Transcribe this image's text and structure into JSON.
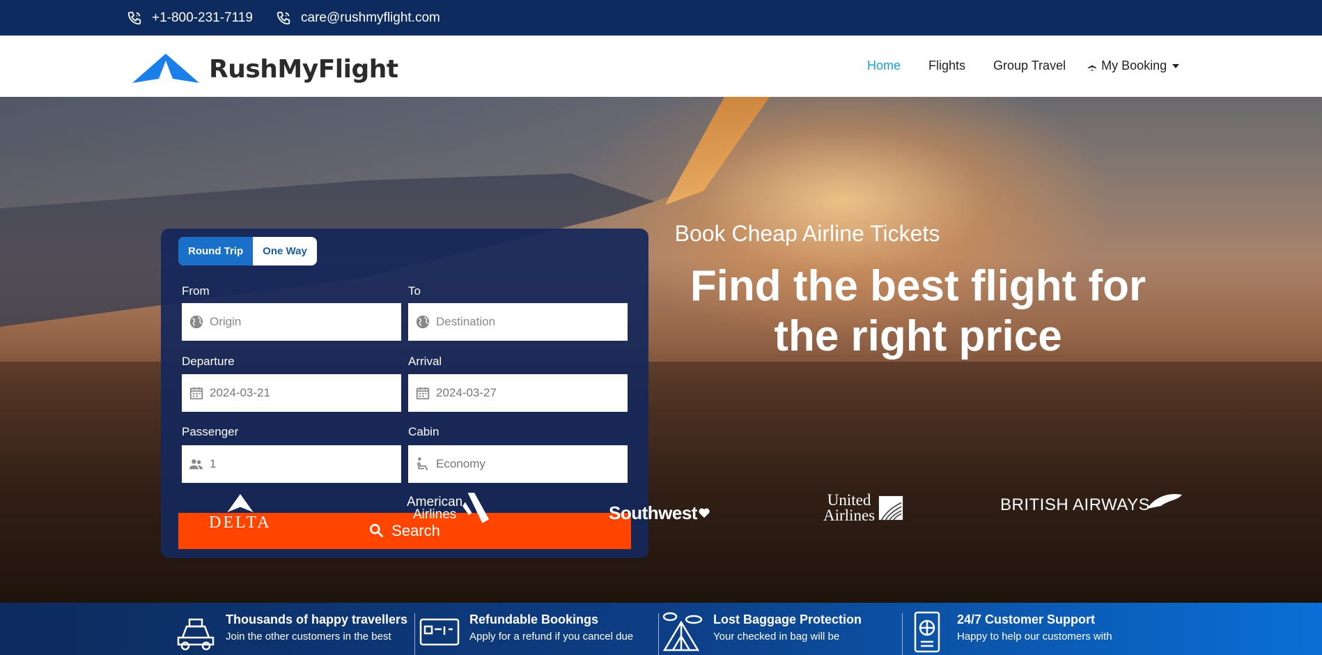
{
  "topbar": {
    "phone": "+1-800-231-7119",
    "email": "care@rushmyflight.com"
  },
  "brand": {
    "name": "RushMyFlight",
    "logo_color": "#1a7fe8"
  },
  "nav": {
    "items": [
      {
        "label": "Home",
        "active": true
      },
      {
        "label": "Flights",
        "active": false
      },
      {
        "label": "Group Travel",
        "active": false
      }
    ],
    "dropdown": {
      "label": "My Booking",
      "icon": "plane-icon"
    }
  },
  "search": {
    "trip_types": [
      "Round Trip",
      "One Way"
    ],
    "selected_trip": "Round Trip",
    "from": {
      "label": "From",
      "placeholder": "Origin",
      "icon": "globe-icon"
    },
    "to": {
      "label": "To",
      "placeholder": "Destination",
      "icon": "globe-icon"
    },
    "departure": {
      "label": "Departure",
      "value": "2024-03-21",
      "icon": "calendar-icon"
    },
    "arrival": {
      "label": "Arrival",
      "value": "2024-03-27",
      "icon": "calendar-icon"
    },
    "passenger": {
      "label": "Passenger",
      "value": "1",
      "icon": "people-icon"
    },
    "cabin": {
      "label": "Cabin",
      "value": "Economy",
      "icon": "seat-icon"
    },
    "button_label": "Search",
    "button_color": "#ff4500"
  },
  "hero": {
    "subtitle": "Book Cheap Airline Tickets",
    "title_line1": "Find the best flight for",
    "title_line2": "the right price"
  },
  "airlines": {
    "delta": "DELTA",
    "american_line1": "American",
    "american_line2": "Airlines",
    "southwest": "Southwest",
    "united_line1": "United",
    "united_line2": "Airlines",
    "british": "BRITISH AIRWAYS"
  },
  "features": [
    {
      "title": "Thousands of happy travellers",
      "desc": "Join the other customers in the best",
      "icon": "car-icon"
    },
    {
      "title": "Refundable Bookings",
      "desc": "Apply for a refund if you cancel due",
      "icon": "ticket-icon"
    },
    {
      "title": "Lost Baggage Protection",
      "desc": "Your checked in bag will be",
      "icon": "tent-icon"
    },
    {
      "title": "24/7 Customer Support",
      "desc": "Happy to help our customers with",
      "icon": "passport-icon"
    }
  ]
}
